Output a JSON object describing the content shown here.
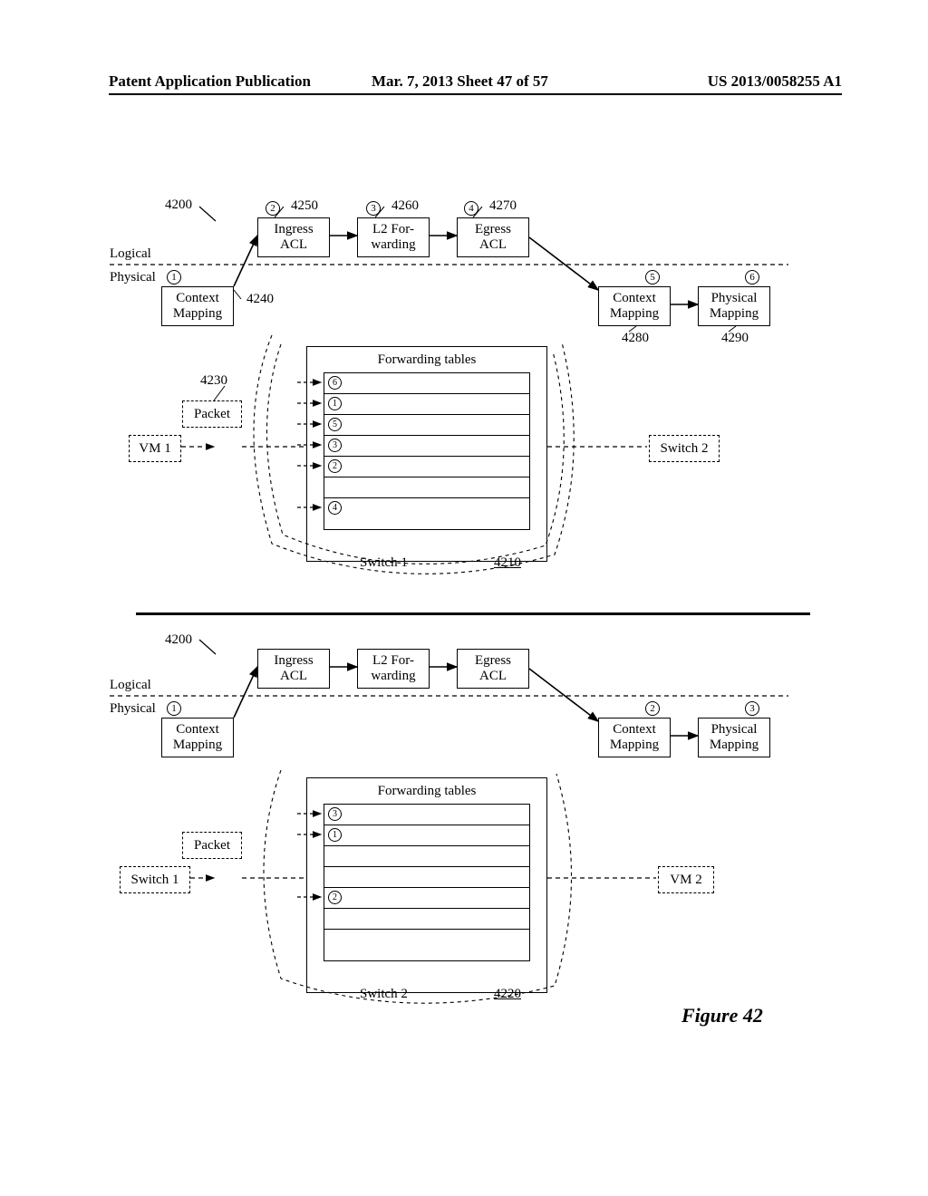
{
  "header": {
    "left": "Patent Application Publication",
    "mid": "Mar. 7, 2013  Sheet 47 of 57",
    "right": "US 2013/0058255 A1"
  },
  "figureLabel": "Figure 42",
  "common": {
    "logical": "Logical",
    "physical": "Physical",
    "ingressACL": "Ingress\nACL",
    "l2fwd": "L2 For-\nwarding",
    "egressACL": "Egress\nACL",
    "contextMapping": "Context\nMapping",
    "physicalMapping": "Physical\nMapping",
    "packet": "Packet",
    "fwdTables": "Forwarding tables"
  },
  "top": {
    "ref4200": "4200",
    "ref4250": "4250",
    "ref4260": "4260",
    "ref4270": "4270",
    "ref4240": "4240",
    "ref4280": "4280",
    "ref4290": "4290",
    "ref4230": "4230",
    "vm1": "VM 1",
    "switch2": "Switch 2",
    "switchName": "Switch 1",
    "switchNum": "4210",
    "steps": {
      "s1": "1",
      "s2": "2",
      "s3": "3",
      "s4": "4",
      "s5": "5",
      "s6": "6"
    },
    "rows": [
      "6",
      "1",
      "5",
      "3",
      "2",
      "",
      "4"
    ]
  },
  "bottom": {
    "ref4200": "4200",
    "switch1": "Switch 1",
    "vm2": "VM 2",
    "switchName": "Switch 2",
    "switchNum": "4220",
    "steps": {
      "s1": "1",
      "s2": "2",
      "s3": "3"
    },
    "rows": [
      "3",
      "1",
      "",
      "",
      "2",
      "",
      ""
    ]
  }
}
